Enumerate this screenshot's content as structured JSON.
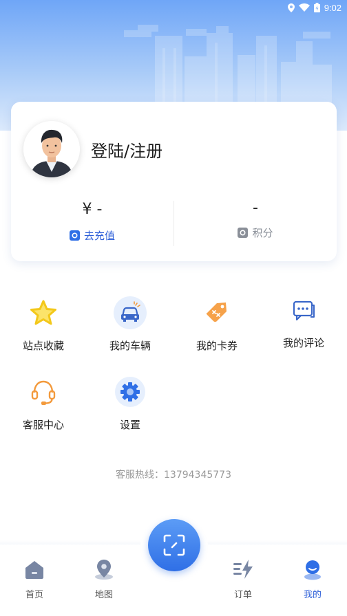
{
  "status_bar": {
    "time": "9:02",
    "icons": [
      "location-icon",
      "wifi-icon",
      "battery-icon"
    ]
  },
  "profile": {
    "login_label": "登陆/注册",
    "balance_value": "¥ -",
    "recharge_label": "去充值",
    "points_value": "-",
    "points_label": "积分"
  },
  "menu": {
    "items": [
      {
        "label": "站点收藏",
        "icon": "star-icon"
      },
      {
        "label": "我的车辆",
        "icon": "car-icon"
      },
      {
        "label": "我的卡券",
        "icon": "coupon-tag-icon"
      },
      {
        "label": "我的评论",
        "icon": "comment-icon"
      },
      {
        "label": "客服中心",
        "icon": "headset-icon"
      },
      {
        "label": "设置",
        "icon": "gear-icon"
      }
    ]
  },
  "hotline": "客服热线：13794345773",
  "tabbar": {
    "items": [
      {
        "label": "首页",
        "icon": "home-icon"
      },
      {
        "label": "地图",
        "icon": "map-pin-icon"
      },
      {
        "label": "订单",
        "icon": "charge-bolt-icon"
      },
      {
        "label": "我的",
        "icon": "person-icon"
      }
    ],
    "active": "我的",
    "center_icon": "scan-icon"
  },
  "colors": {
    "accent": "#2d5fd8",
    "hero_top": "#6fa6f7",
    "star": "#f6cf1f",
    "orange": "#f39a3c",
    "muted": "#9a9a9a"
  }
}
